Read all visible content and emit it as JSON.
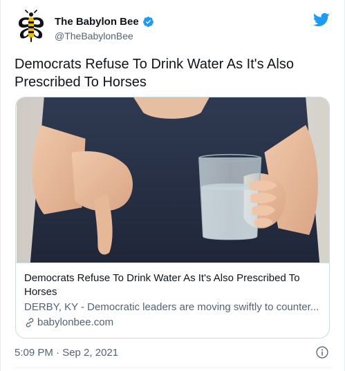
{
  "account": {
    "display_name": "The Babylon Bee",
    "handle": "@TheBabylonBee",
    "verified": true
  },
  "tweet": {
    "text": "Democrats Refuse To Drink Water As It's Also Prescribed To Horses",
    "timestamp": "5:09 PM · Sep 2, 2021"
  },
  "card": {
    "title": "Democrats Refuse To Drink Water As It's Also Prescribed To Horses",
    "description": "DERBY, KY - Democratic leaders are moving swiftly to counter...",
    "domain": "babylonbee.com"
  },
  "colors": {
    "twitter_blue": "#1d9bf0",
    "secondary_text": "#536471",
    "border": "#cfd9de"
  },
  "icons": {
    "logo": "bee-logo-icon",
    "verified": "verified-badge-icon",
    "brand": "twitter-bird-icon",
    "link": "link-icon",
    "info": "info-icon"
  }
}
